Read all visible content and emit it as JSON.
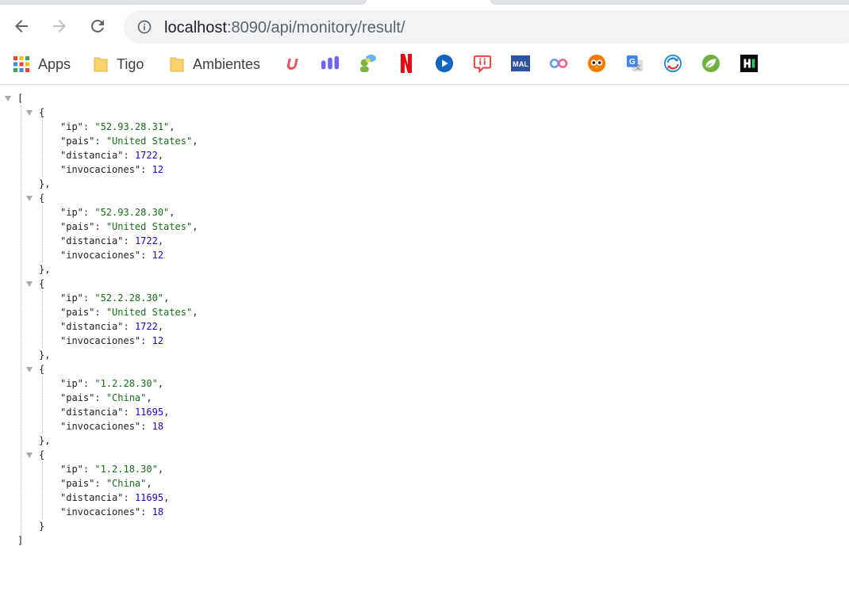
{
  "browser": {
    "url_host": "localhost",
    "url_path": ":8090/api/monitory/result/"
  },
  "bookmarks": [
    {
      "label": "Apps",
      "icon": "apps-grid-icon"
    },
    {
      "label": "Tigo",
      "icon": "folder-icon"
    },
    {
      "label": "Ambientes",
      "icon": "folder-icon"
    },
    {
      "label": "",
      "icon": "udemy-icon"
    },
    {
      "label": "",
      "icon": "bars-logo-icon"
    },
    {
      "label": "",
      "icon": "chat-people-icon"
    },
    {
      "label": "",
      "icon": "netflix-icon"
    },
    {
      "label": "",
      "icon": "play-circle-icon"
    },
    {
      "label": "",
      "icon": "speech-bubble-icon"
    },
    {
      "label": "",
      "icon": "mal-icon"
    },
    {
      "label": "",
      "icon": "rings-icon"
    },
    {
      "label": "",
      "icon": "owl-icon"
    },
    {
      "label": "",
      "icon": "google-translate-icon"
    },
    {
      "label": "",
      "icon": "sync-circle-icon"
    },
    {
      "label": "",
      "icon": "spring-leaf-icon"
    },
    {
      "label": "",
      "icon": "hackerrank-icon"
    }
  ],
  "json": {
    "open_bracket": "[",
    "close_bracket": "]",
    "open_brace": "{",
    "close_brace_comma": "},",
    "close_brace": "}",
    "keys": {
      "ip": "\"ip\"",
      "pais": "\"pais\"",
      "distancia": "\"distancia\"",
      "invocaciones": "\"invocaciones\""
    },
    "items": [
      {
        "ip": "\"52.93.28.31\"",
        "pais": "\"United States\"",
        "distancia": "1722",
        "invocaciones": "12"
      },
      {
        "ip": "\"52.93.28.30\"",
        "pais": "\"United States\"",
        "distancia": "1722",
        "invocaciones": "12"
      },
      {
        "ip": "\"52.2.28.30\"",
        "pais": "\"United States\"",
        "distancia": "1722",
        "invocaciones": "12"
      },
      {
        "ip": "\"1.2.28.30\"",
        "pais": "\"China\"",
        "distancia": "11695",
        "invocaciones": "18"
      },
      {
        "ip": "\"1.2.18.30\"",
        "pais": "\"China\"",
        "distancia": "11695",
        "invocaciones": "18"
      }
    ]
  }
}
